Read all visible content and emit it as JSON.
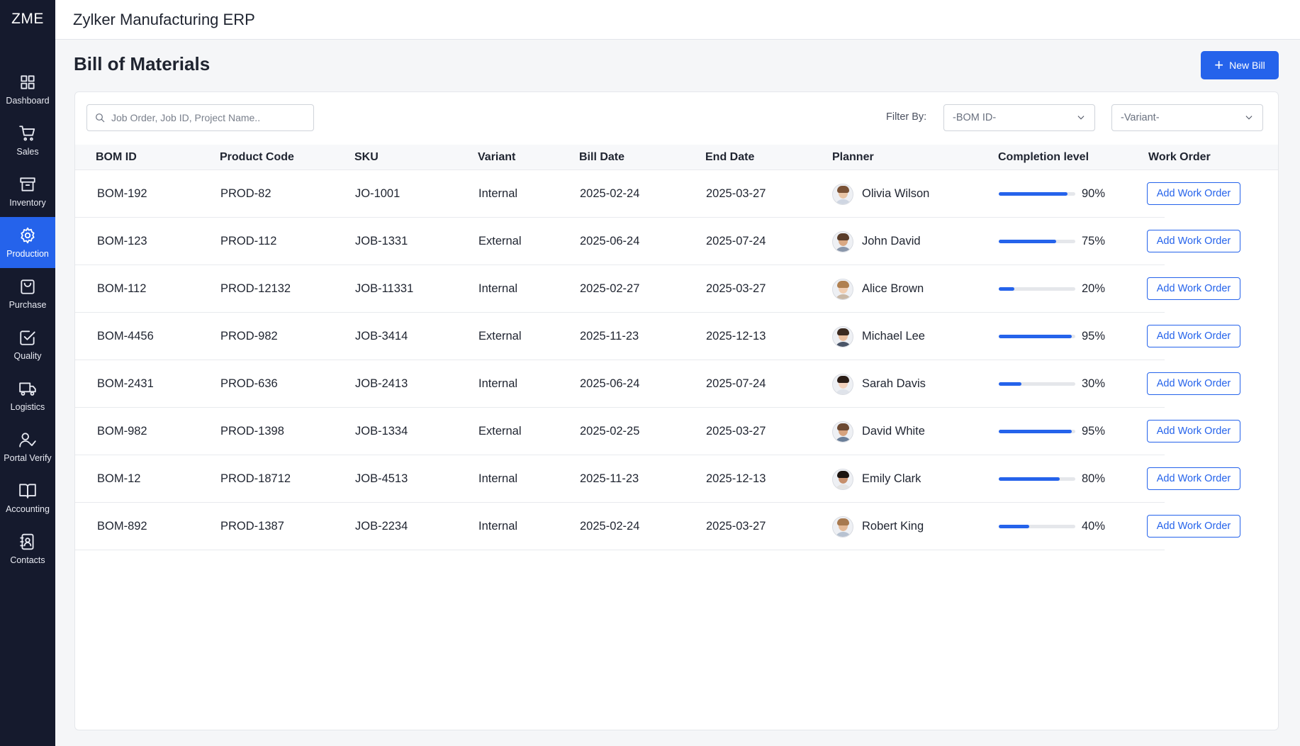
{
  "app": {
    "brand": "ZME",
    "title": "Zylker Manufacturing ERP"
  },
  "sidebar": {
    "items": [
      {
        "label": "Dashboard",
        "icon": "dashboard-icon",
        "active": false
      },
      {
        "label": "Sales",
        "icon": "cart-icon",
        "active": false
      },
      {
        "label": "Inventory",
        "icon": "archive-icon",
        "active": false
      },
      {
        "label": "Production",
        "icon": "gear-icon",
        "active": true
      },
      {
        "label": "Purchase",
        "icon": "shopping-bag-icon",
        "active": false
      },
      {
        "label": "Quality",
        "icon": "check-square-icon",
        "active": false
      },
      {
        "label": "Logistics",
        "icon": "truck-icon",
        "active": false
      },
      {
        "label": "Portal Verify",
        "icon": "user-check-icon",
        "active": false
      },
      {
        "label": "Accounting",
        "icon": "book-icon",
        "active": false
      },
      {
        "label": "Contacts",
        "icon": "contact-book-icon",
        "active": false
      }
    ]
  },
  "page": {
    "title": "Bill of Materials",
    "new_button": "New Bill"
  },
  "toolbar": {
    "search_placeholder": "Job Order, Job ID, Project Name..",
    "filter_label": "Filter By:",
    "bom_select": "-BOM ID-",
    "variant_select": "-Variant-"
  },
  "table": {
    "headers": [
      "BOM ID",
      "Product Code",
      "SKU",
      "Variant",
      "Bill Date",
      "End Date",
      "Planner",
      "Completion level",
      "Work Order"
    ],
    "action_label": "Add Work Order",
    "accent_color": "#2563eb",
    "rows": [
      {
        "bom": "BOM-192",
        "product": "PROD-82",
        "sku": "JO-1001",
        "variant": "Internal",
        "bill_date": "2025-02-24",
        "end_date": "2025-03-27",
        "planner": "Olivia Wilson",
        "completion": 0.9,
        "completion_text": "90%"
      },
      {
        "bom": "BOM-123",
        "product": "PROD-112",
        "sku": "JOB-1331",
        "variant": "External",
        "bill_date": "2025-06-24",
        "end_date": "2025-07-24",
        "planner": "John David",
        "completion": 0.75,
        "completion_text": "75%"
      },
      {
        "bom": "BOM-112",
        "product": "PROD-12132",
        "sku": "JOB-11331",
        "variant": "Internal",
        "bill_date": "2025-02-27",
        "end_date": "2025-03-27",
        "planner": "Alice Brown",
        "completion": 0.2,
        "completion_text": "20%"
      },
      {
        "bom": "BOM-4456",
        "product": "PROD-982",
        "sku": "JOB-3414",
        "variant": "External",
        "bill_date": "2025-11-23",
        "end_date": "2025-12-13",
        "planner": "Michael Lee",
        "completion": 0.95,
        "completion_text": "95%"
      },
      {
        "bom": "BOM-2431",
        "product": "PROD-636",
        "sku": "JOB-2413",
        "variant": "Internal",
        "bill_date": "2025-06-24",
        "end_date": "2025-07-24",
        "planner": "Sarah Davis",
        "completion": 0.3,
        "completion_text": "30%"
      },
      {
        "bom": "BOM-982",
        "product": "PROD-1398",
        "sku": "JOB-1334",
        "variant": "External",
        "bill_date": "2025-02-25",
        "end_date": "2025-03-27",
        "planner": "David White",
        "completion": 0.95,
        "completion_text": "95%"
      },
      {
        "bom": "BOM-12",
        "product": "PROD-18712",
        "sku": "JOB-4513",
        "variant": "Internal",
        "bill_date": "2025-11-23",
        "end_date": "2025-12-13",
        "planner": "Emily Clark",
        "completion": 0.8,
        "completion_text": "80%"
      },
      {
        "bom": "BOM-892",
        "product": "PROD-1387",
        "sku": "JOB-2234",
        "variant": "Internal",
        "bill_date": "2025-02-24",
        "end_date": "2025-03-27",
        "planner": "Robert King",
        "completion": 0.4,
        "completion_text": "40%"
      }
    ]
  }
}
